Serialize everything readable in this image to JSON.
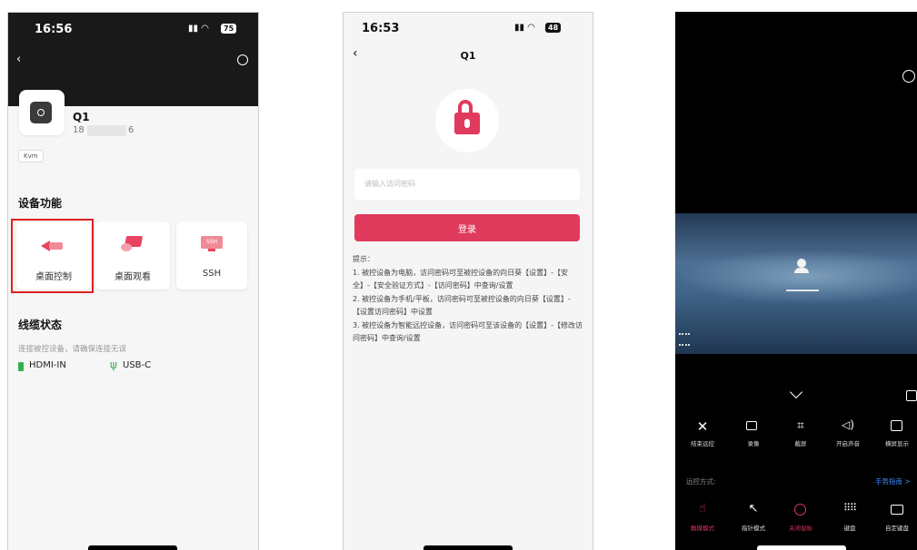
{
  "phone1": {
    "time": "16:56",
    "battery": "75",
    "device": {
      "name": "Q1",
      "id_prefix": "18",
      "id_suffix": "6"
    },
    "tag": "Kvm",
    "functions_title": "设备功能",
    "functions": [
      {
        "label": "桌面控制",
        "icon": "desktop-control-icon"
      },
      {
        "label": "桌面观看",
        "icon": "desktop-view-icon"
      },
      {
        "label": "SSH",
        "icon": "ssh-icon"
      }
    ],
    "ssh_badge": "SSH",
    "cable_title": "线缆状态",
    "cable_hint": "连接被控设备，请确保连接无误",
    "cables": [
      {
        "label": "HDMI-IN",
        "icon": "hdmi-icon",
        "color": "#2fb14e"
      },
      {
        "label": "USB-C",
        "icon": "usb-icon",
        "color": "#2fb14e"
      }
    ],
    "highlight_color": "#e02020"
  },
  "phone2": {
    "time": "16:53",
    "battery": "48",
    "title": "Q1",
    "password_placeholder": "请输入访问密码",
    "login_label": "登录",
    "accent": "#e03a5c",
    "tips_title": "提示：",
    "tips": [
      "1. 被控设备为电脑，访问密码可至被控设备的向日葵【设置】-【安全】-【安全验证方式】-【访问密码】中查询/设置",
      "2. 被控设备为手机/平板，访问密码可至被控设备的向日葵【设置】-【设置访问密码】中设置",
      "3. 被控设备为智能远控设备，访问密码可至该设备的【设置】-【修改访问密码】中查询/设置"
    ]
  },
  "phone3": {
    "controls": [
      {
        "label": "结束远控",
        "icon": "close-icon"
      },
      {
        "label": "录像",
        "icon": "record-icon"
      },
      {
        "label": "截屏",
        "icon": "crop-icon"
      },
      {
        "label": "开启声音",
        "icon": "sound-icon"
      },
      {
        "label": "横屏显示",
        "icon": "landscape-icon"
      }
    ],
    "mode_label": "远控方式:",
    "guide_link": "手势指南 >",
    "modes": [
      {
        "label": "触摸模式",
        "icon": "touch-icon",
        "active": true
      },
      {
        "label": "指针模式",
        "icon": "pointer-icon",
        "active": false
      },
      {
        "label": "关闭鼠标",
        "icon": "mouse-off-icon",
        "active": true
      },
      {
        "label": "键盘",
        "icon": "keyboard-icon",
        "active": false
      },
      {
        "label": "自定键盘",
        "icon": "custom-keyboard-icon",
        "active": false
      }
    ],
    "accent": "#e0335a"
  }
}
